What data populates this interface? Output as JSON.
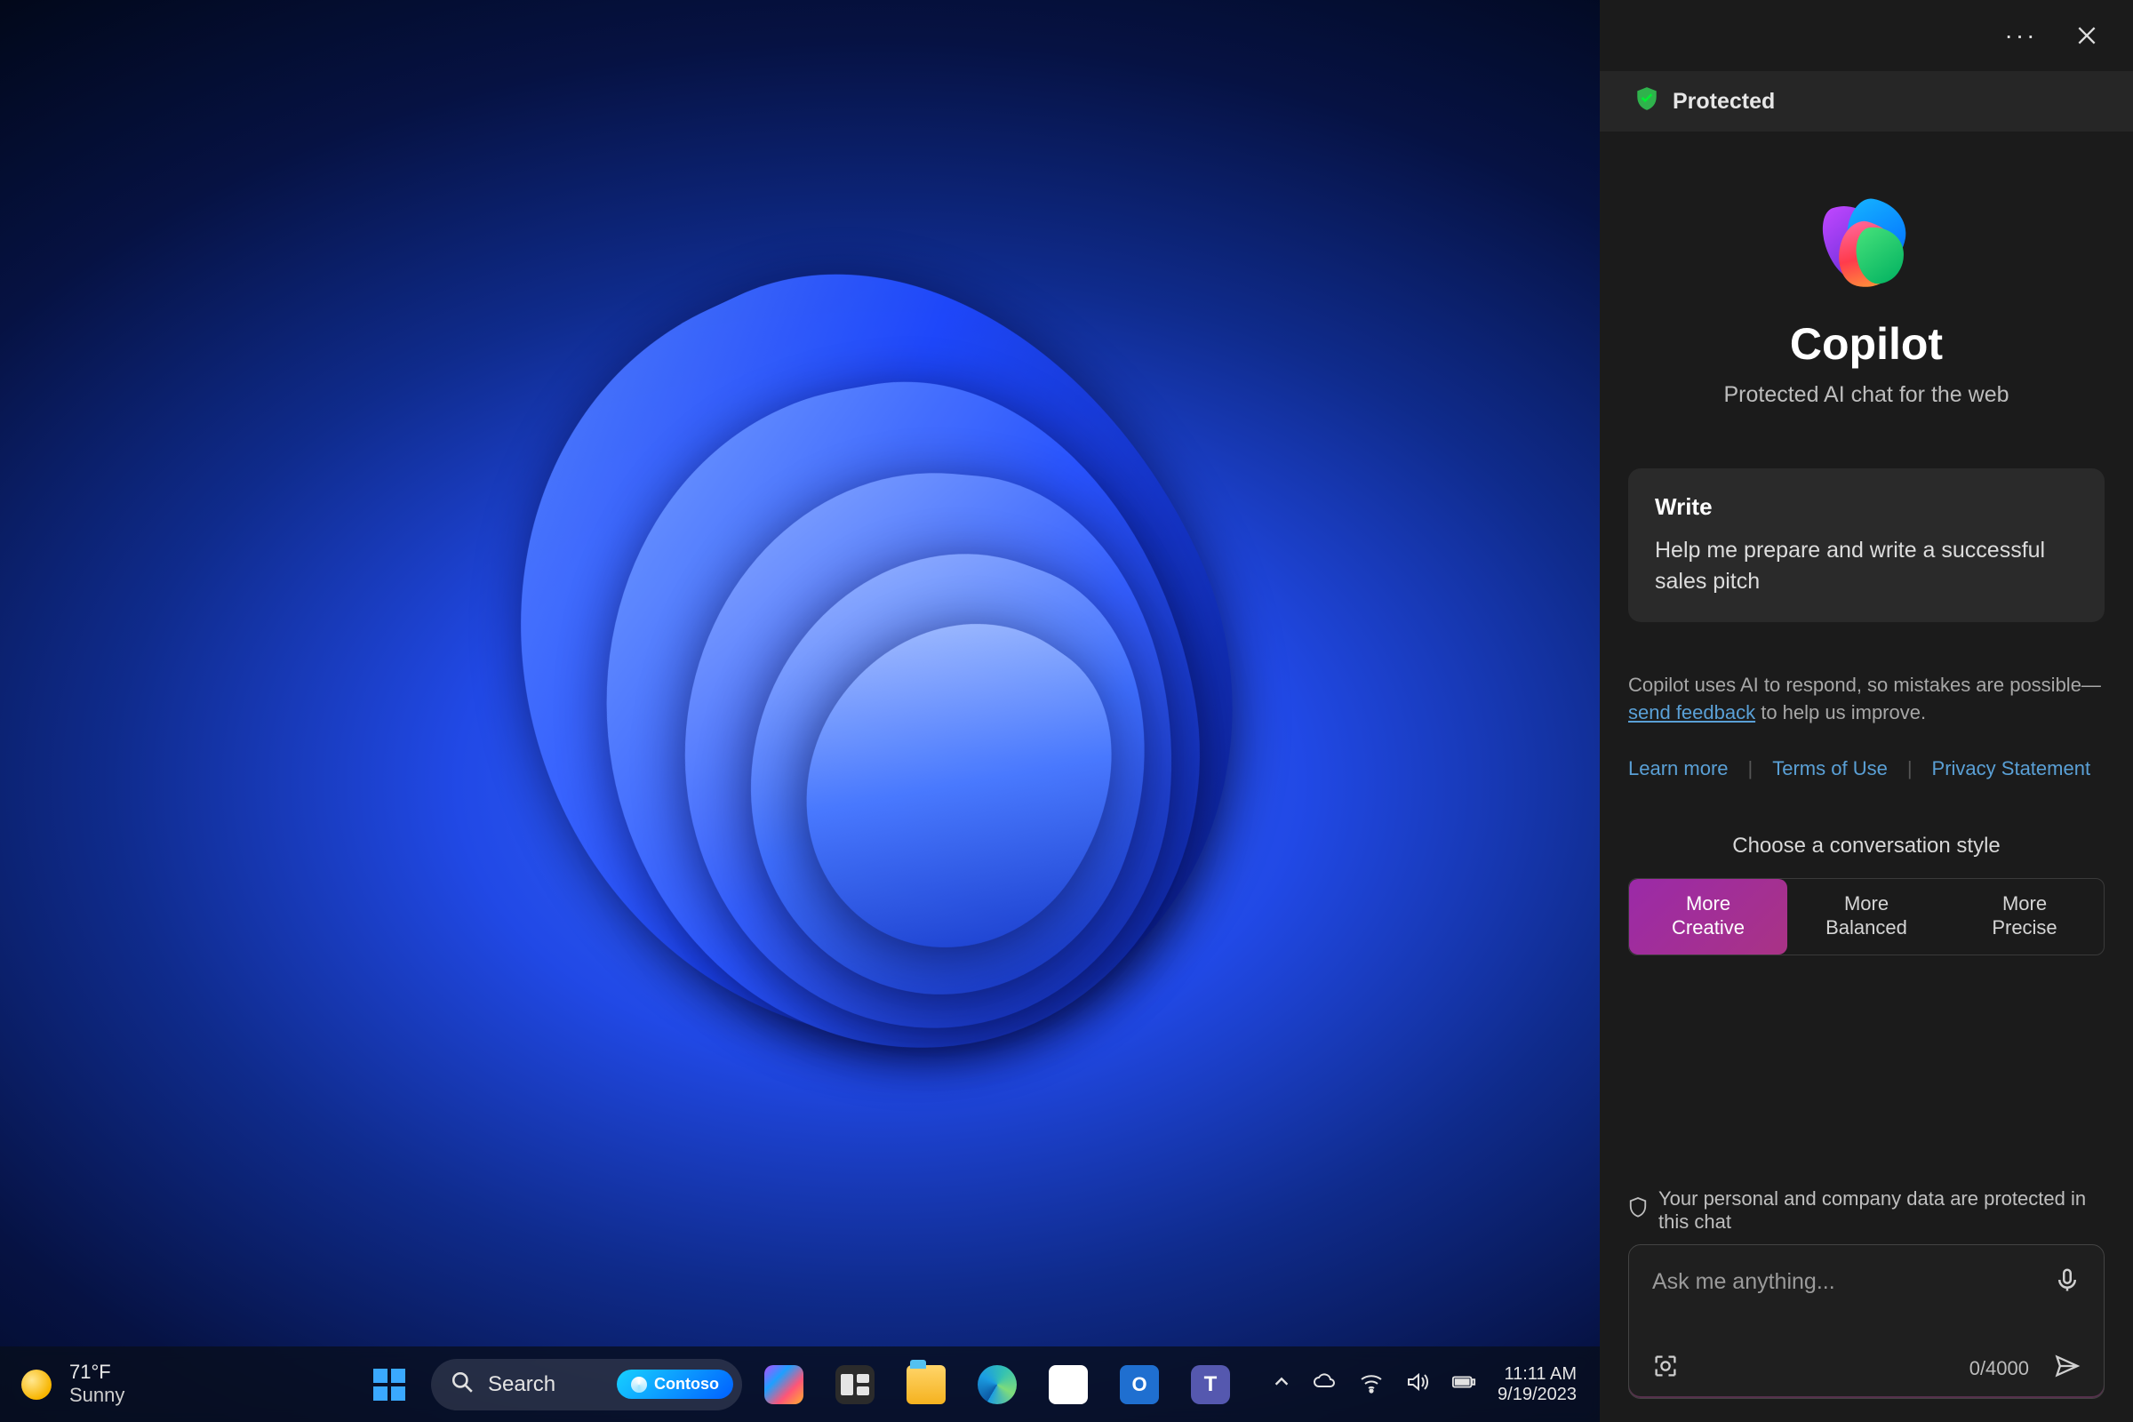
{
  "copilot": {
    "protected_label": "Protected",
    "title": "Copilot",
    "subtitle": "Protected AI chat for the web",
    "card": {
      "title": "Write",
      "description": "Help me prepare and write a successful sales pitch"
    },
    "disclaimer_text": "Copilot uses AI to respond, so mistakes are possible—",
    "disclaimer_link": "send feedback",
    "disclaimer_tail": " to help us improve.",
    "links": {
      "learn": "Learn more",
      "terms": "Terms of Use",
      "privacy": "Privacy Statement"
    },
    "style_heading": "Choose a conversation style",
    "styles": [
      {
        "line1": "More",
        "line2": "Creative",
        "active": true
      },
      {
        "line1": "More",
        "line2": "Balanced",
        "active": false
      },
      {
        "line1": "More",
        "line2": "Precise",
        "active": false
      }
    ],
    "privacy_note": "Your personal and company data are protected in this chat",
    "input_placeholder": "Ask me anything...",
    "counter": "0/4000"
  },
  "taskbar": {
    "weather": {
      "temp": "71°F",
      "condition": "Sunny"
    },
    "search_label": "Search",
    "contoso_label": "Contoso",
    "clock": {
      "time": "11:11 AM",
      "date": "9/19/2023"
    }
  }
}
